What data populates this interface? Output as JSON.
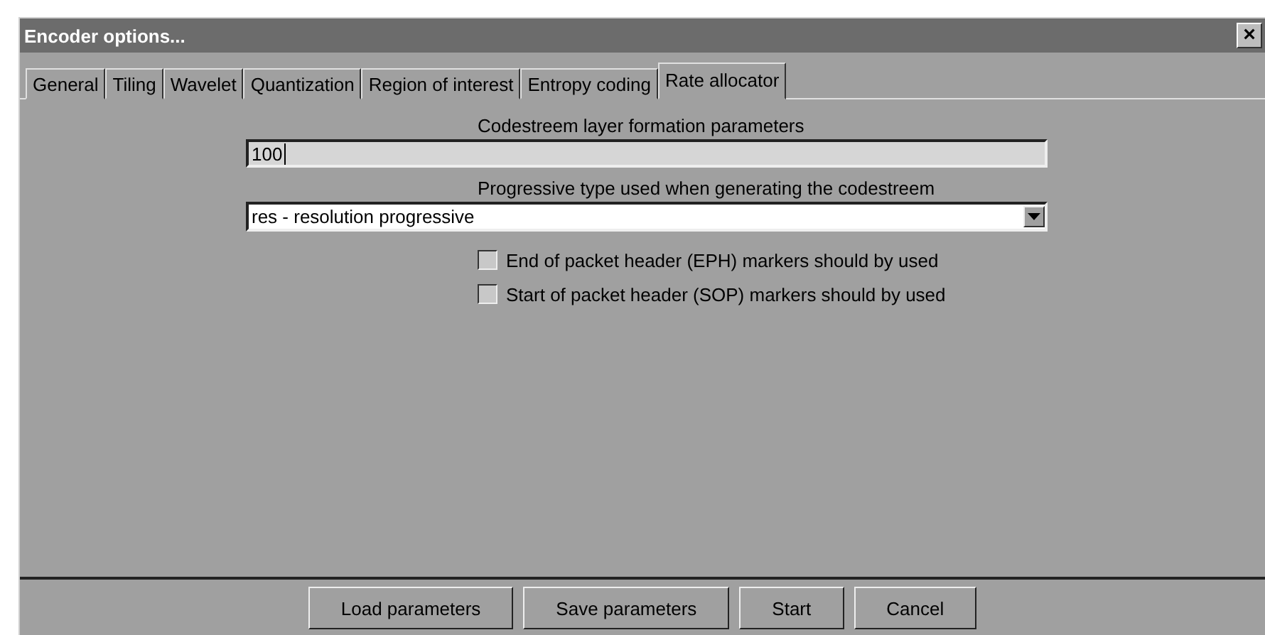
{
  "window": {
    "title": "Encoder options...",
    "close": "×"
  },
  "tabs": [
    {
      "label": "General",
      "selected": false
    },
    {
      "label": "Tiling",
      "selected": false
    },
    {
      "label": "Wavelet",
      "selected": false
    },
    {
      "label": "Quantization",
      "selected": false
    },
    {
      "label": "Region of interest",
      "selected": false
    },
    {
      "label": "Entropy coding",
      "selected": false
    },
    {
      "label": "Rate allocator",
      "selected": true
    }
  ],
  "layers": {
    "label": "Codestreem layer formation parameters",
    "value": "100"
  },
  "progression": {
    "label": "Progressive type used when generating the codestreem",
    "value": "res - resolution progressive"
  },
  "options": [
    {
      "label": "End of packet header (EPH) markers should by used",
      "checked": false
    },
    {
      "label": "Start of packet header (SOP) markers should by used",
      "checked": false
    }
  ],
  "buttons": [
    "Load parameters",
    "Save parameters",
    "Start",
    "Cancel"
  ]
}
